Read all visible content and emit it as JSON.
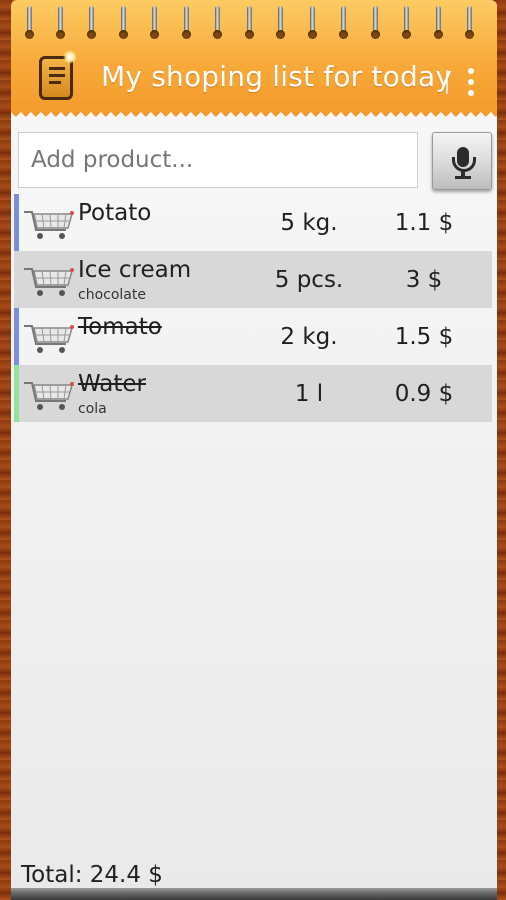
{
  "header": {
    "title": "My shoping list for today",
    "app_icon": "shopping-list-app-icon",
    "overflow_icon": "overflow-menu-icon",
    "accent_color": "#f8a93a"
  },
  "search": {
    "placeholder": "Add product...",
    "value": "",
    "voice_icon": "microphone-icon"
  },
  "items": [
    {
      "name": "Potato",
      "note": "",
      "qty": "5 kg.",
      "price": "1.1 $",
      "purchased": false,
      "marker_color": "#7b8fd6",
      "shaded": false
    },
    {
      "name": "Ice cream",
      "note": "chocolate",
      "qty": "5 pcs.",
      "price": "3 $",
      "purchased": false,
      "marker_color": "",
      "shaded": true
    },
    {
      "name": "Tomato",
      "note": "",
      "qty": "2 kg.",
      "price": "1.5 $",
      "purchased": true,
      "marker_color": "#7b8fd6",
      "shaded": false
    },
    {
      "name": "Water",
      "note": "cola",
      "qty": "1 l",
      "price": "0.9 $",
      "purchased": true,
      "marker_color": "#8fe39a",
      "shaded": true
    }
  ],
  "footer": {
    "total": "Total: 24.4 $"
  }
}
